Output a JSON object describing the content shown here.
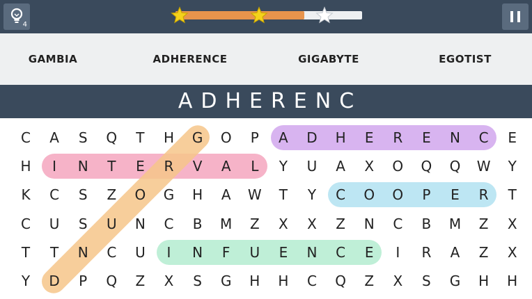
{
  "hint": {
    "count": "4",
    "icon": "lightbulb-icon"
  },
  "progress": {
    "fraction": 0.69,
    "stars_earned": 2,
    "stars_total": 3,
    "fill_color": "#e8944c"
  },
  "pause": {
    "icon": "pause-icon"
  },
  "words": [
    "GAMBIA",
    "ADHERENCE",
    "GIGABYTE",
    "EGOTIST"
  ],
  "current_word": "ADHERENC",
  "grid": [
    [
      "C",
      "A",
      "S",
      "Q",
      "T",
      "H",
      "G",
      "O",
      "P",
      "A",
      "D",
      "H",
      "E",
      "R",
      "E",
      "N",
      "C",
      "E"
    ],
    [
      "H",
      "I",
      "N",
      "T",
      "E",
      "R",
      "V",
      "A",
      "L",
      "Y",
      "U",
      "A",
      "X",
      "O",
      "Q",
      "Q",
      "W",
      "Y"
    ],
    [
      "K",
      "C",
      "S",
      "Z",
      "O",
      "G",
      "H",
      "A",
      "W",
      "T",
      "Y",
      "C",
      "O",
      "O",
      "P",
      "E",
      "R",
      "T"
    ],
    [
      "C",
      "U",
      "S",
      "U",
      "N",
      "C",
      "B",
      "M",
      "Z",
      "X",
      "X",
      "Z",
      "N",
      "C",
      "B",
      "M",
      "Z",
      "X"
    ],
    [
      "T",
      "T",
      "N",
      "C",
      "U",
      "I",
      "N",
      "F",
      "U",
      "E",
      "N",
      "C",
      "E",
      "I",
      "R",
      "A",
      "Z",
      "X"
    ],
    [
      "Y",
      "D",
      "P",
      "Q",
      "Z",
      "X",
      "S",
      "G",
      "H",
      "H",
      "C",
      "Q",
      "Z",
      "X",
      "S",
      "G",
      "H",
      "H"
    ]
  ],
  "found_words": [
    {
      "word": "ADHERENCE",
      "row": 0,
      "col_start": 9,
      "col_end": 16,
      "color": "#d8b4f0"
    },
    {
      "word": "INTERVAL",
      "row": 1,
      "col_start": 1,
      "col_end": 8,
      "color": "#f6b3c8"
    },
    {
      "word": "COOPER",
      "row": 2,
      "col_start": 11,
      "col_end": 16,
      "color": "#bde6f3"
    },
    {
      "word": "INFUENCE",
      "row": 4,
      "col_start": 5,
      "col_end": 12,
      "color": "#bfefd7"
    }
  ],
  "diagonal_selection": {
    "color": "#f6c58a"
  }
}
